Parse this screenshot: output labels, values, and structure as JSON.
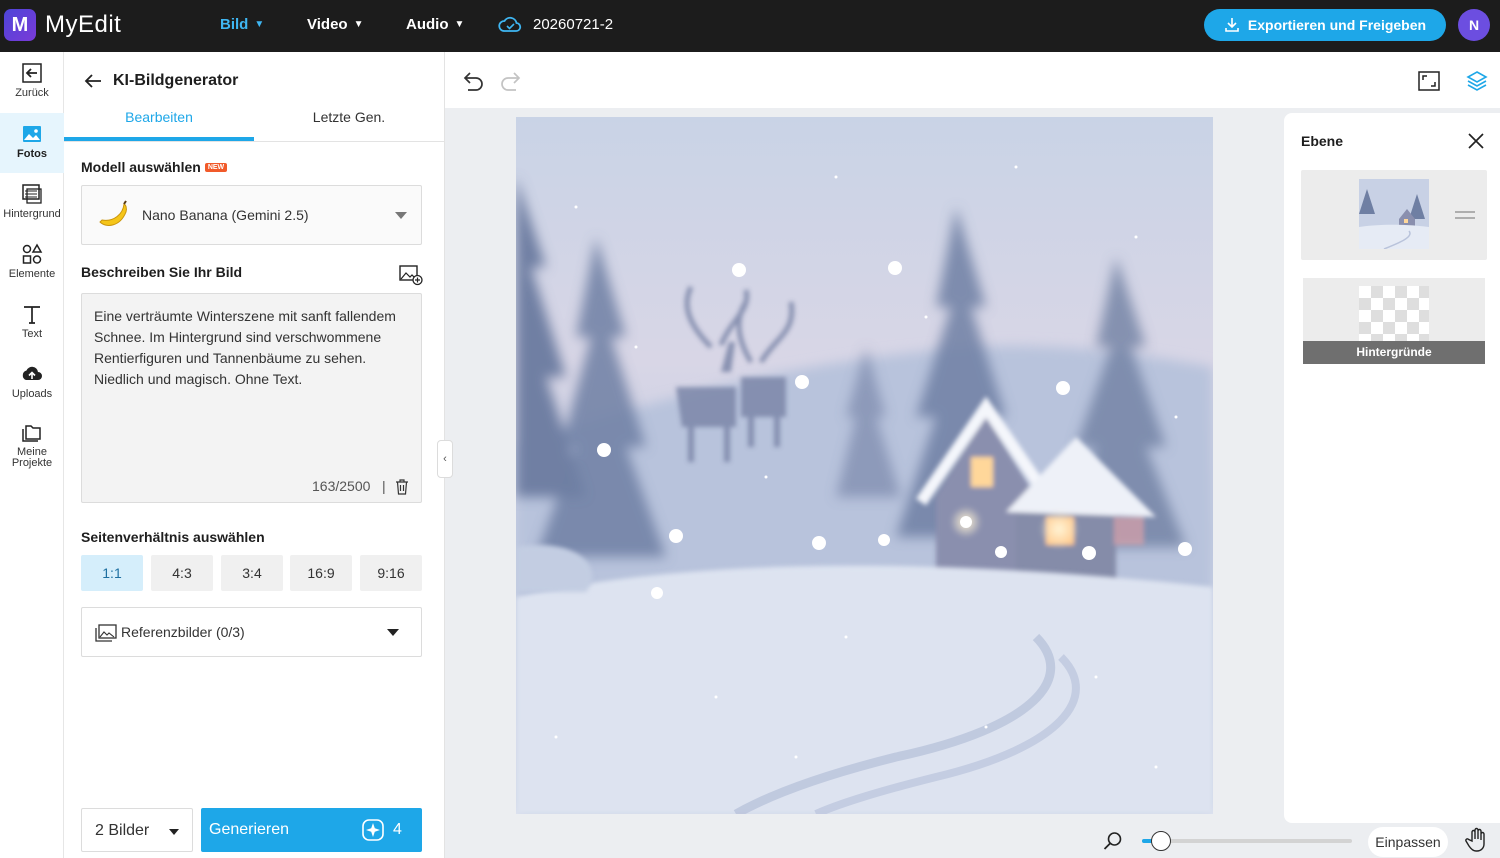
{
  "app": {
    "logo_letter": "M",
    "name": "MyEdit",
    "accent": "#1ea7e8",
    "nav": [
      {
        "label": "Bild",
        "active": true
      },
      {
        "label": "Video",
        "active": false
      },
      {
        "label": "Audio",
        "active": false
      }
    ],
    "project_name": "20260721-2",
    "export_label": "Exportieren und Freigeben",
    "avatar_initial": "N"
  },
  "rail": {
    "items": [
      {
        "label": "Zurück",
        "icon": "back-icon"
      },
      {
        "label": "Fotos",
        "icon": "photos-icon",
        "active": true
      },
      {
        "label": "Hintergrund",
        "icon": "background-icon"
      },
      {
        "label": "Elemente",
        "icon": "elements-icon"
      },
      {
        "label": "Text",
        "icon": "text-icon"
      },
      {
        "label": "Uploads",
        "icon": "upload-icon"
      },
      {
        "label": "Meine Projekte",
        "icon": "folder-icon"
      }
    ]
  },
  "panel": {
    "title": "KI-Bildgenerator",
    "tabs": [
      {
        "label": "Bearbeiten",
        "active": true
      },
      {
        "label": "Letzte Gen.",
        "active": false
      }
    ],
    "model_label": "Modell auswählen",
    "new_badge": "NEW",
    "model_value": "Nano Banana (Gemini 2.5)",
    "describe_label": "Beschreiben Sie Ihr Bild",
    "prompt": "Eine verträumte Winterszene mit sanft fallendem Schnee. Im Hintergrund sind verschwommene Rentierfiguren und Tannenbäume zu sehen. Niedlich und magisch. Ohne Text.",
    "char_count": "163/2500",
    "char_sep": "|",
    "ratio_label": "Seitenverhältnis auswählen",
    "ratios": [
      {
        "label": "1:1",
        "active": true
      },
      {
        "label": "4:3",
        "active": false
      },
      {
        "label": "3:4",
        "active": false
      },
      {
        "label": "16:9",
        "active": false
      },
      {
        "label": "9:16",
        "active": false
      }
    ],
    "reference_label": "Referenzbilder (0/3)",
    "image_count": "2 Bilder",
    "generate_label": "Generieren",
    "credits": "4"
  },
  "canvas": {
    "zoom_fraction": 0.09,
    "fit_label": "Einpassen"
  },
  "layers": {
    "title": "Ebene",
    "background_label": "Hintergründe"
  }
}
